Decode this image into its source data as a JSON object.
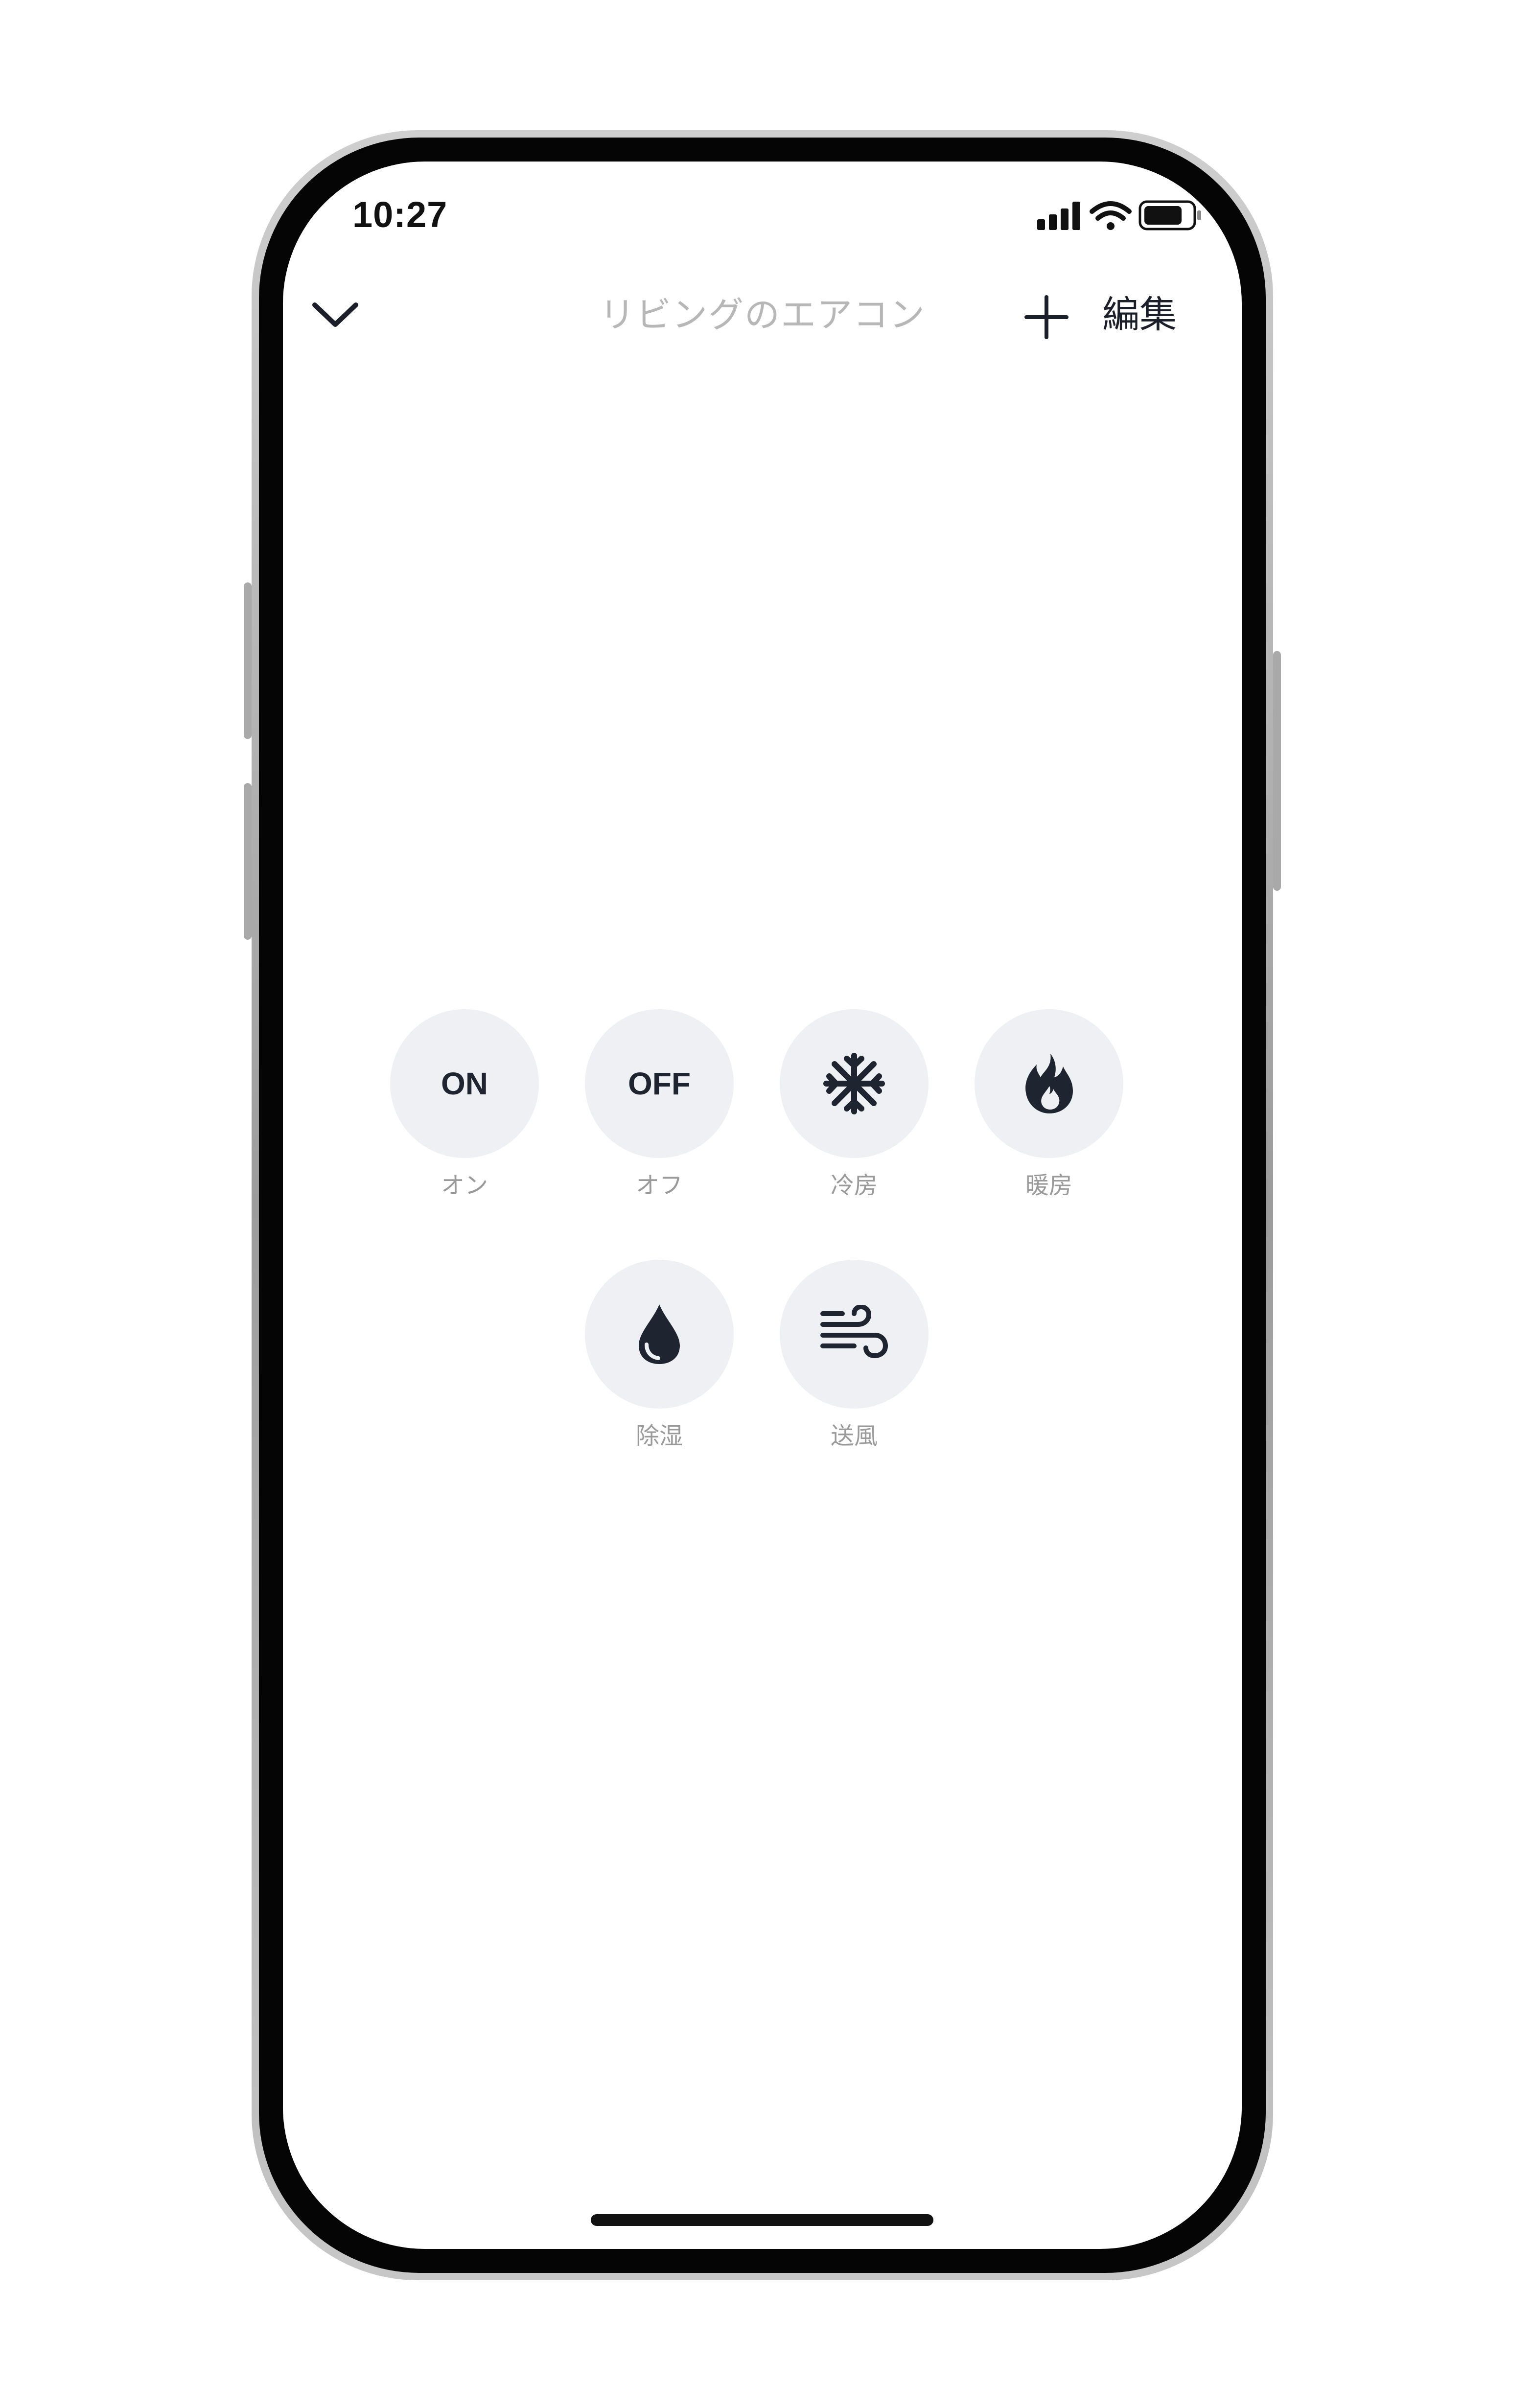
{
  "status_bar": {
    "time": "10:27"
  },
  "header": {
    "title": "リビングのエアコン",
    "edit_label": "編集",
    "icons": {
      "back": "chevron-down-icon",
      "add": "plus-icon"
    }
  },
  "actions": [
    {
      "id": "on",
      "icon_text": "ON",
      "label": "オン"
    },
    {
      "id": "off",
      "icon_text": "OFF",
      "label": "オフ"
    },
    {
      "id": "cool",
      "icon": "snowflake-icon",
      "label": "冷房"
    },
    {
      "id": "heat",
      "icon": "flame-icon",
      "label": "暖房"
    },
    {
      "id": "dry",
      "icon": "water-drop-icon",
      "label": "除湿"
    },
    {
      "id": "fan",
      "icon": "wind-icon",
      "label": "送風"
    }
  ],
  "colors": {
    "button_bg": "#eef0f3",
    "icon": "#1e2530",
    "label": "#9a9a9a",
    "title": "#b7b7b7"
  }
}
